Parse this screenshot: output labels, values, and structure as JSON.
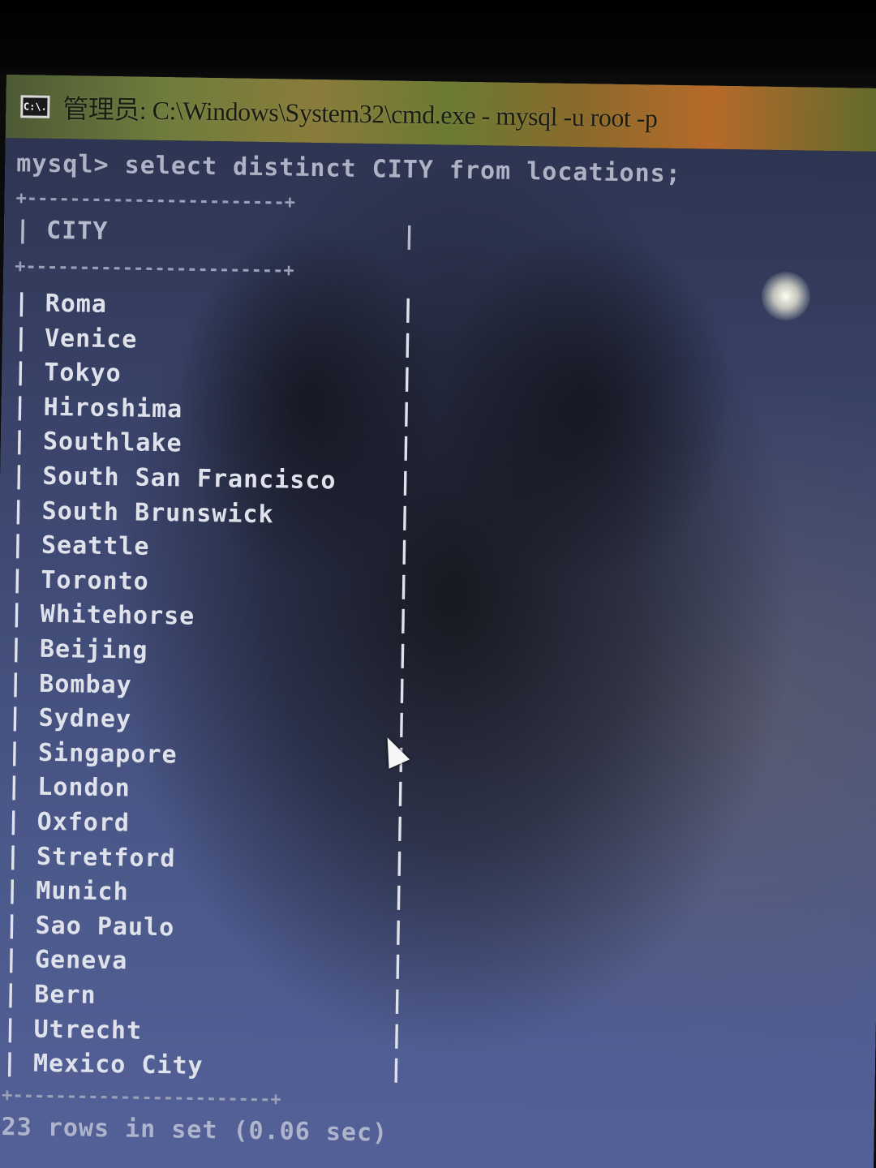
{
  "window": {
    "icon_text": "C:\\.",
    "title": "管理员: C:\\Windows\\System32\\cmd.exe - mysql -u root -p"
  },
  "console": {
    "prompt": "mysql> select distinct CITY from locations;",
    "border": "+------------------------+",
    "column_header": "| CITY                   |",
    "rows": [
      "| Roma                   |",
      "| Venice                 |",
      "| Tokyo                  |",
      "| Hiroshima              |",
      "| Southlake              |",
      "| South San Francisco    |",
      "| South Brunswick        |",
      "| Seattle                |",
      "| Toronto                |",
      "| Whitehorse             |",
      "| Beijing                |",
      "| Bombay                 |",
      "| Sydney                 |",
      "| Singapore              |",
      "| London                 |",
      "| Oxford                 |",
      "| Stretford              |",
      "| Munich                 |",
      "| Sao Paulo              |",
      "| Geneva                 |",
      "| Bern                   |",
      "| Utrecht                |",
      "| Mexico City            |"
    ],
    "footer": "23 rows in set (0.06 sec)"
  },
  "colors": {
    "console_background": "#3d4770",
    "text": "#dfe2ea",
    "title_bar": "#6f7c3d"
  }
}
